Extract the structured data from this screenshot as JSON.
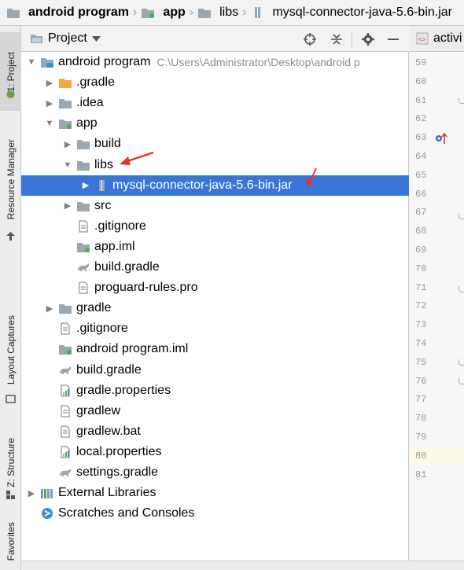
{
  "breadcrumb": [
    {
      "label": "android program",
      "icon": "folder-icon",
      "bold": true
    },
    {
      "label": "app",
      "icon": "module-folder-icon",
      "bold": true
    },
    {
      "label": "libs",
      "icon": "folder-icon",
      "bold": false
    },
    {
      "label": "mysql-connector-java-5.6-bin.jar",
      "icon": "jar-icon",
      "bold": false
    }
  ],
  "left_stripe": {
    "project": "1: Project",
    "resource_manager": "Resource Manager",
    "layout_captures": "Layout Captures",
    "structure": "Z: Structure",
    "favorites": "Favorites"
  },
  "panel": {
    "title": "Project",
    "toolbar": [
      "locate-icon",
      "collapse-icon",
      "gear-icon",
      "hide-icon"
    ]
  },
  "tree": [
    {
      "label": "android program",
      "hint": "C:\\Users\\Administrator\\Desktop\\android p",
      "level": 0,
      "arrow": "down",
      "icon": "project-folder"
    },
    {
      "label": ".gradle",
      "level": 1,
      "arrow": "right",
      "icon": "folder-orange"
    },
    {
      "label": ".idea",
      "level": 1,
      "arrow": "right",
      "icon": "folder"
    },
    {
      "label": "app",
      "level": 1,
      "arrow": "down",
      "icon": "module-folder"
    },
    {
      "label": "build",
      "level": 2,
      "arrow": "right",
      "icon": "folder"
    },
    {
      "label": "libs",
      "level": 2,
      "arrow": "down",
      "icon": "folder"
    },
    {
      "label": "mysql-connector-java-5.6-bin.jar",
      "level": 3,
      "arrow": "right",
      "icon": "jar",
      "selected": true
    },
    {
      "label": "src",
      "level": 2,
      "arrow": "right",
      "icon": "folder"
    },
    {
      "label": ".gitignore",
      "level": 2,
      "arrow": "none",
      "icon": "text-file"
    },
    {
      "label": "app.iml",
      "level": 2,
      "arrow": "none",
      "icon": "iml-file"
    },
    {
      "label": "build.gradle",
      "level": 2,
      "arrow": "none",
      "icon": "gradle-file"
    },
    {
      "label": "proguard-rules.pro",
      "level": 2,
      "arrow": "none",
      "icon": "text-file"
    },
    {
      "label": "gradle",
      "level": 1,
      "arrow": "right",
      "icon": "folder"
    },
    {
      "label": ".gitignore",
      "level": 1,
      "arrow": "none",
      "icon": "text-file"
    },
    {
      "label": "android program.iml",
      "level": 1,
      "arrow": "none",
      "icon": "iml-file"
    },
    {
      "label": "build.gradle",
      "level": 1,
      "arrow": "none",
      "icon": "gradle-file"
    },
    {
      "label": "gradle.properties",
      "level": 1,
      "arrow": "none",
      "icon": "properties-file"
    },
    {
      "label": "gradlew",
      "level": 1,
      "arrow": "none",
      "icon": "text-file"
    },
    {
      "label": "gradlew.bat",
      "level": 1,
      "arrow": "none",
      "icon": "text-file"
    },
    {
      "label": "local.properties",
      "level": 1,
      "arrow": "none",
      "icon": "properties-file"
    },
    {
      "label": "settings.gradle",
      "level": 1,
      "arrow": "none",
      "icon": "gradle-file"
    },
    {
      "label": "External Libraries",
      "level": 0,
      "arrow": "right",
      "icon": "libraries"
    },
    {
      "label": "Scratches and Consoles",
      "level": 0,
      "arrow": "none",
      "icon": "scratches"
    }
  ],
  "editor": {
    "tab_label": "activi",
    "lines": [
      "59",
      "60",
      "61",
      "62",
      "63",
      "64",
      "65",
      "66",
      "67",
      "68",
      "69",
      "70",
      "71",
      "72",
      "73",
      "74",
      "75",
      "76",
      "77",
      "78",
      "79",
      "80",
      "81"
    ],
    "current_line": "80"
  },
  "colors": {
    "selection": "#3875d7",
    "folder": "#9aa7b0",
    "folder_orange": "#f4a640",
    "annotation_arrow": "#e8302a"
  }
}
